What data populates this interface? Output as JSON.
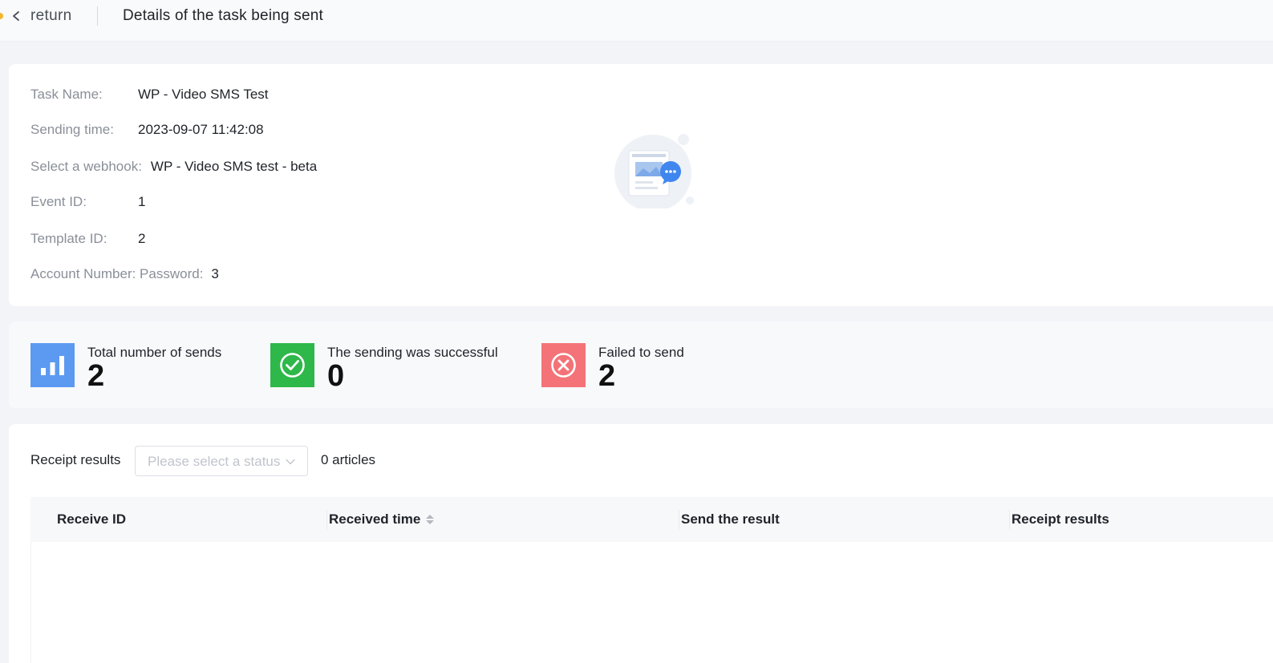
{
  "header": {
    "back_label": "return",
    "title": "Details of the task being sent"
  },
  "info": {
    "task_name_label": "Task Name:",
    "task_name": "WP - Video SMS Test",
    "sending_time_label": "Sending time:",
    "sending_time": "2023-09-07 11:42:08",
    "webhook_label": "Select a webhook:",
    "webhook": "WP - Video SMS test - beta",
    "event_id_label": "Event ID:",
    "event_id": "1",
    "template_id_label": "Template ID:",
    "template_id": "2",
    "account_label": "Account Number: Password:",
    "account": "3"
  },
  "stats": {
    "total_label": "Total number of sends",
    "total_value": "2",
    "success_label": "The sending was successful",
    "success_value": "0",
    "failed_label": "Failed to send",
    "failed_value": "2",
    "colors": {
      "total": "#5b9af0",
      "success": "#2eb84a",
      "failed": "#f47378"
    },
    "icons": {
      "total": "bar-chart-icon",
      "success": "check-circle-icon",
      "failed": "x-circle-icon"
    }
  },
  "results": {
    "label": "Receipt results",
    "status_placeholder": "Please select a status",
    "count": "0 articles",
    "columns": [
      "Receive ID",
      "Received time",
      "Send the result",
      "Receipt results"
    ],
    "rows": []
  }
}
